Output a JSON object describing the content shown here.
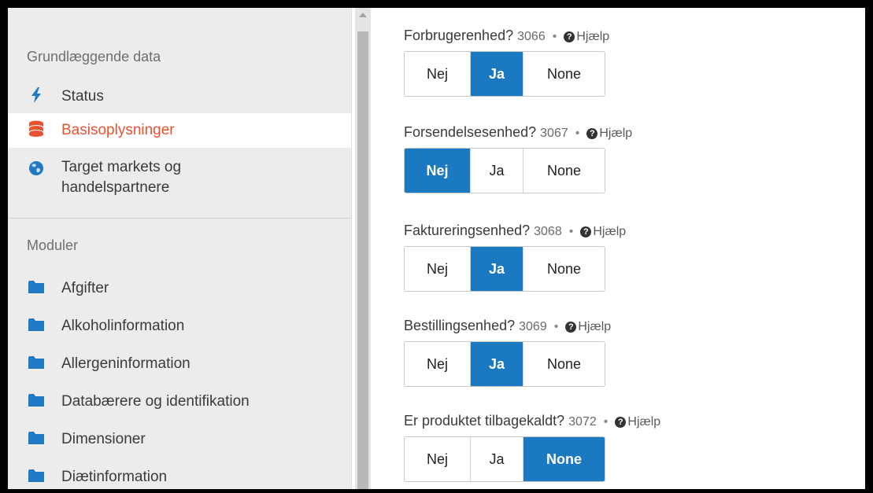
{
  "sidebar": {
    "section1_title": "Grundlæggende data",
    "section1_items": [
      {
        "label": "Status",
        "icon": "lightning-icon"
      },
      {
        "label": "Basisoplysninger",
        "icon": "database-icon",
        "active": true
      },
      {
        "label": "Target markets og handelspartnere",
        "icon": "globe-icon"
      }
    ],
    "section2_title": "Moduler",
    "section2_items": [
      {
        "label": "Afgifter",
        "icon": "folder-icon"
      },
      {
        "label": "Alkoholinformation",
        "icon": "folder-icon"
      },
      {
        "label": "Allergeninformation",
        "icon": "folder-icon"
      },
      {
        "label": "Databærere og identifikation",
        "icon": "folder-icon"
      },
      {
        "label": "Dimensioner",
        "icon": "folder-icon"
      },
      {
        "label": "Diætinformation",
        "icon": "folder-icon"
      }
    ]
  },
  "options": {
    "nej": "Nej",
    "ja": "Ja",
    "none": "None"
  },
  "help_label": "Hjælp",
  "fields": [
    {
      "label": "Forbrugerenhed?",
      "code": "3066",
      "selected": "Ja"
    },
    {
      "label": "Forsendelsesenhed?",
      "code": "3067",
      "selected": "Nej"
    },
    {
      "label": "Faktureringsenhed?",
      "code": "3068",
      "selected": "Ja"
    },
    {
      "label": "Bestillingsenhed?",
      "code": "3069",
      "selected": "Ja"
    },
    {
      "label": "Er produktet tilbagekaldt?",
      "code": "3072",
      "selected": "None"
    }
  ],
  "colors": {
    "accent": "#1b79c2",
    "active_nav": "#e8532f",
    "icon_blue": "#1f79c4",
    "icon_orange": "#e8532f"
  }
}
